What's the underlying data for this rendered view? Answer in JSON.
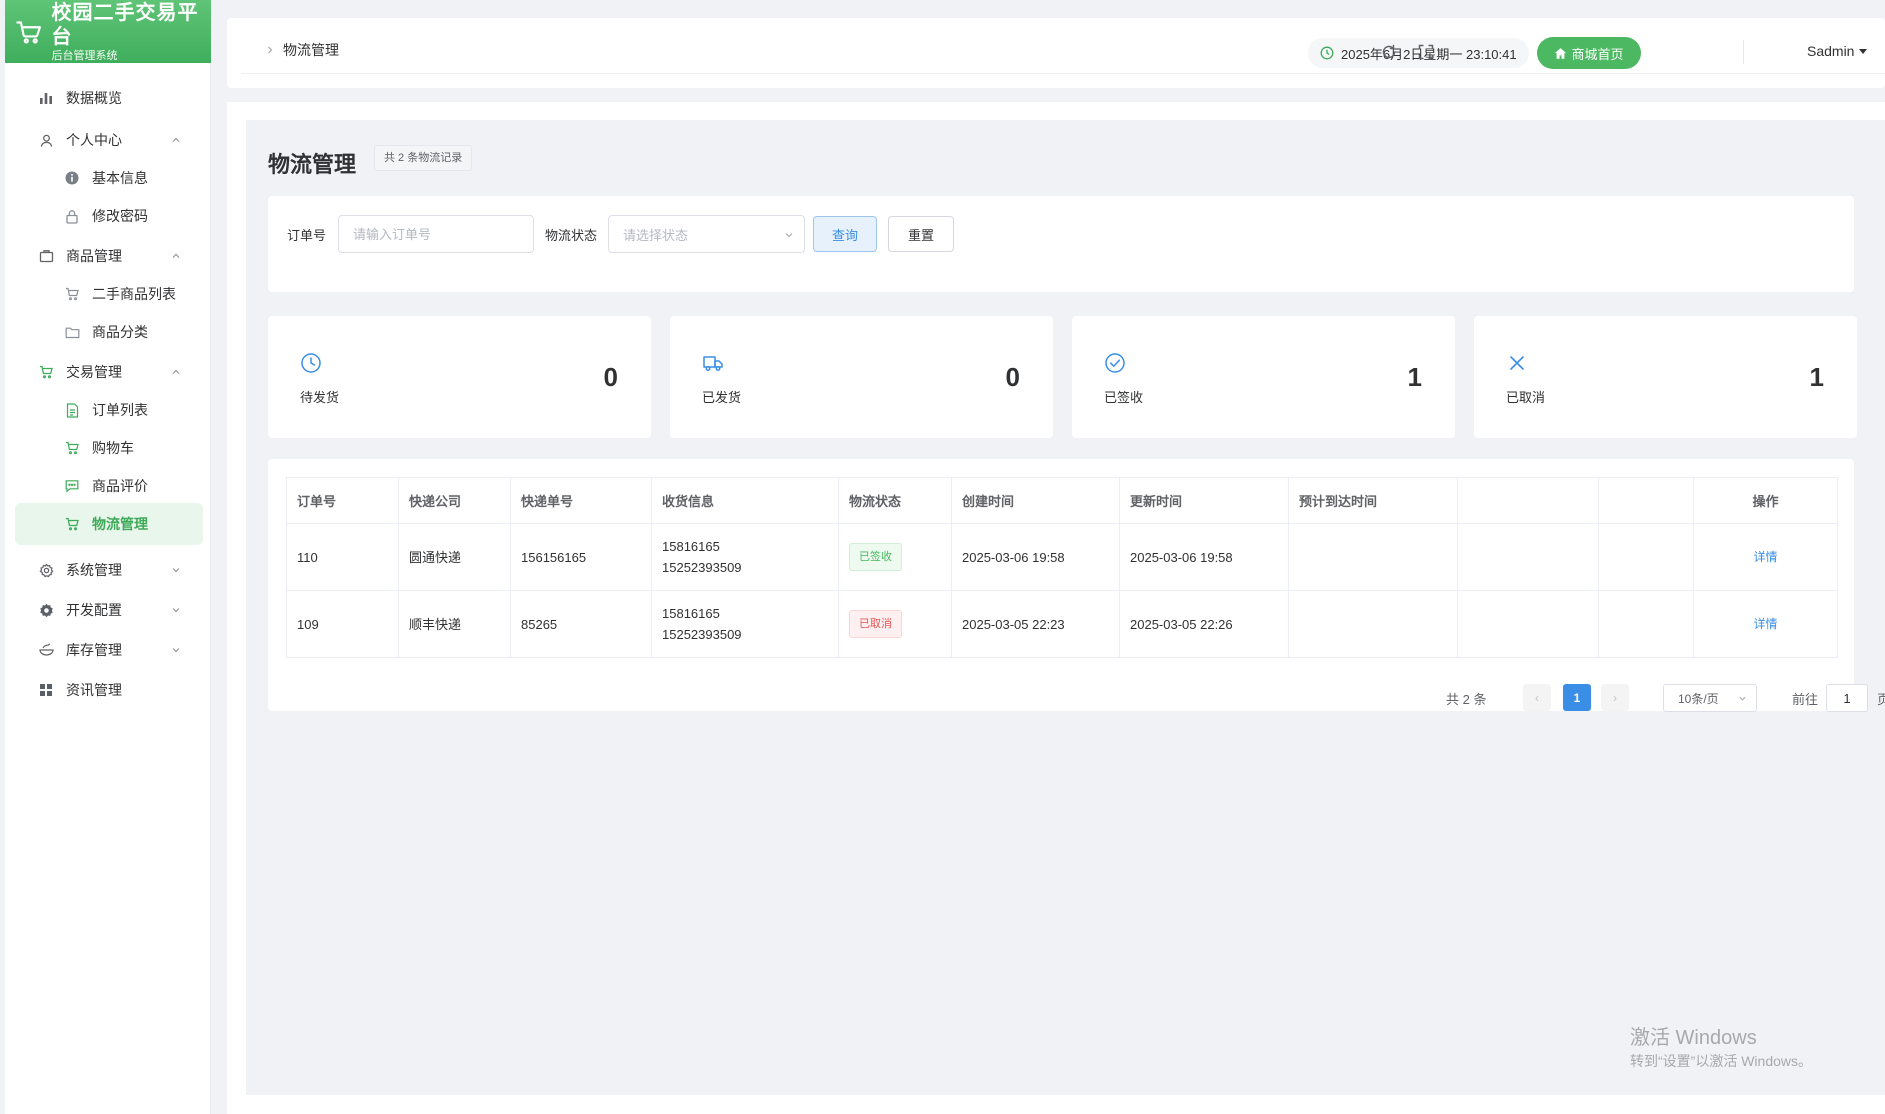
{
  "brand": {
    "title": "校园二手交易平台",
    "subtitle": "后台管理系统"
  },
  "sidebar": {
    "items": [
      {
        "label": "数据概览",
        "icon": "bar-chart-icon"
      },
      {
        "label": "个人中心",
        "icon": "user-icon",
        "expanded": true
      },
      {
        "label": "基本信息",
        "icon": "info-icon"
      },
      {
        "label": "修改密码",
        "icon": "lock-icon"
      },
      {
        "label": "商品管理",
        "icon": "briefcase-icon",
        "expanded": true
      },
      {
        "label": "二手商品列表",
        "icon": "cart-icon"
      },
      {
        "label": "商品分类",
        "icon": "folder-icon"
      },
      {
        "label": "交易管理",
        "icon": "cart-icon",
        "expanded": true
      },
      {
        "label": "订单列表",
        "icon": "document-icon"
      },
      {
        "label": "购物车",
        "icon": "cart-icon"
      },
      {
        "label": "商品评价",
        "icon": "comment-icon"
      },
      {
        "label": "物流管理",
        "icon": "cart-icon",
        "active": true
      },
      {
        "label": "系统管理",
        "icon": "gear-icon",
        "expanded": false
      },
      {
        "label": "开发配置",
        "icon": "setting-icon",
        "expanded": false
      },
      {
        "label": "库存管理",
        "icon": "bowl-icon",
        "expanded": false
      },
      {
        "label": "资讯管理",
        "icon": "grid-icon"
      }
    ]
  },
  "header": {
    "breadcrumb": "物流管理",
    "datetime": "2025年6月2日星期一 23:10:41",
    "home_button": "商城首页",
    "user": "Sadmin"
  },
  "page": {
    "title": "物流管理",
    "count_tag": "共 2 条物流记录"
  },
  "search": {
    "order_label": "订单号",
    "order_placeholder": "请输入订单号",
    "status_label": "物流状态",
    "status_placeholder": "请选择状态",
    "query_button": "查询",
    "reset_button": "重置"
  },
  "stats": [
    {
      "label": "待发货",
      "value": "0",
      "icon": "clock-icon"
    },
    {
      "label": "已发货",
      "value": "0",
      "icon": "truck-icon"
    },
    {
      "label": "已签收",
      "value": "1",
      "icon": "check-circle-icon"
    },
    {
      "label": "已取消",
      "value": "1",
      "icon": "close-icon"
    }
  ],
  "table": {
    "columns": [
      "订单号",
      "快递公司",
      "快递单号",
      "收货信息",
      "物流状态",
      "创建时间",
      "更新时间",
      "预计到达时间",
      "",
      "",
      "操作"
    ],
    "rows": [
      {
        "order_no": "110",
        "company": "圆通快递",
        "tracking": "156156165",
        "receiver_line1": "15816165",
        "receiver_line2": "15252393509",
        "status": "已签收",
        "status_color": "#47b85e",
        "created": "2025-03-06 19:58",
        "updated": "2025-03-06 19:58",
        "eta": "",
        "action": "详情"
      },
      {
        "order_no": "109",
        "company": "顺丰快递",
        "tracking": "85265",
        "receiver_line1": "15816165",
        "receiver_line2": "15252393509",
        "status": "已取消",
        "status_color": "#e45656",
        "created": "2025-03-05 22:23",
        "updated": "2025-03-05 22:26",
        "eta": "",
        "action": "详情"
      }
    ]
  },
  "pagination": {
    "total": "共 2 条",
    "prev": "‹",
    "current": "1",
    "next": "›",
    "page_size": "10条/页",
    "goto_label": "前往",
    "goto_value": "1",
    "page_suffix": "页"
  },
  "watermark": {
    "line1": "激活 Windows",
    "line2": "转到“设置”以激活 Windows。"
  },
  "colors": {
    "brand_green": "#4cb862",
    "primary_blue": "#3a8ee6",
    "success_green": "#47b85e",
    "danger_red": "#e45656"
  }
}
